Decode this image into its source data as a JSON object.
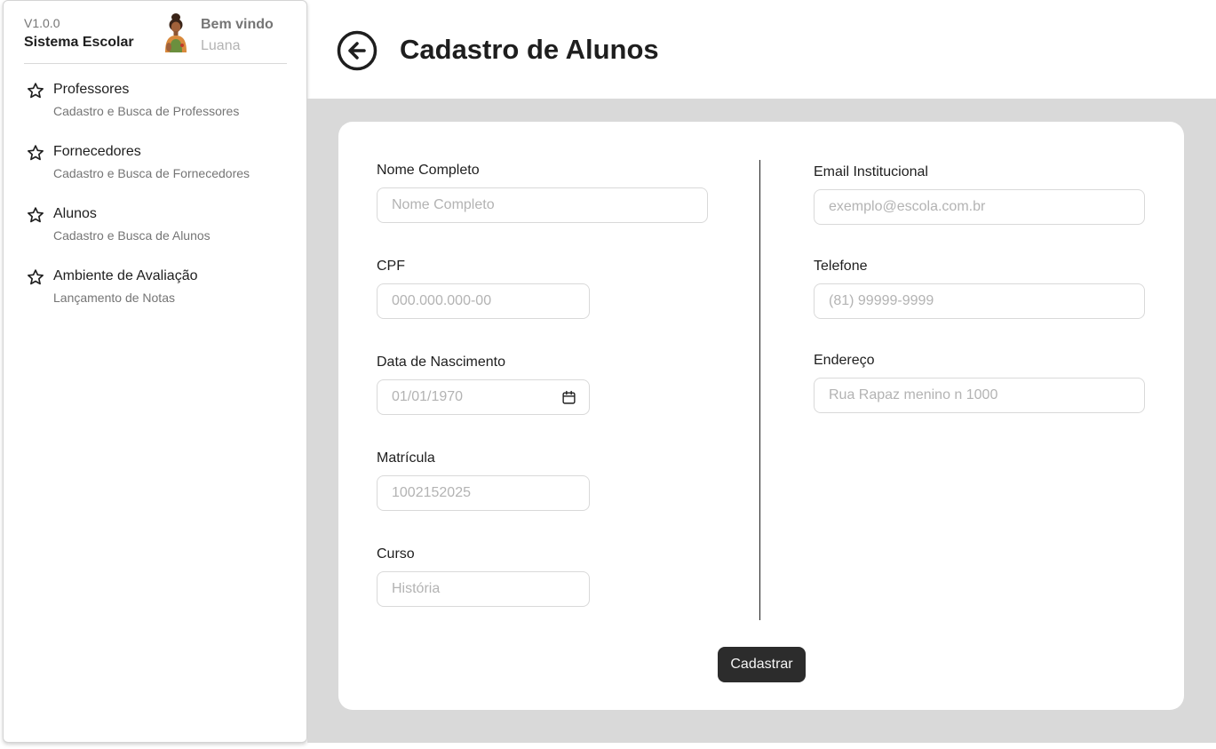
{
  "sidebar": {
    "version": "V1.0.0",
    "app_name": "Sistema Escolar",
    "welcome": "Bem vindo",
    "user_name": "Luana",
    "items": [
      {
        "label": "Professores",
        "description": "Cadastro e Busca de Professores",
        "icon": "star-icon"
      },
      {
        "label": "Fornecedores",
        "description": "Cadastro e Busca de Fornecedores",
        "icon": "star-icon"
      },
      {
        "label": "Alunos",
        "description": "Cadastro e Busca de Alunos",
        "icon": "star-icon"
      },
      {
        "label": "Ambiente de Avaliação",
        "description": "Lançamento de Notas",
        "icon": "star-icon"
      }
    ]
  },
  "header": {
    "title": "Cadastro de Alunos",
    "back_icon": "arrow-left-circle-icon"
  },
  "form": {
    "nome": {
      "label": "Nome Completo",
      "placeholder": "Nome Completo"
    },
    "cpf": {
      "label": "CPF",
      "placeholder": "000.000.000-00"
    },
    "nascimento": {
      "label": "Data de Nascimento",
      "placeholder": "01/01/1970",
      "icon": "calendar-icon"
    },
    "matricula": {
      "label": "Matrícula",
      "placeholder": "1002152025"
    },
    "curso": {
      "label": "Curso",
      "placeholder": "História"
    },
    "email": {
      "label": "Email Institucional",
      "placeholder": "exemplo@escola.com.br"
    },
    "telefone": {
      "label": "Telefone",
      "placeholder": "(81) 99999-9999"
    },
    "endereco": {
      "label": "Endereço",
      "placeholder": "Rua Rapaz menino n 1000"
    },
    "submit_label": "Cadastrar"
  },
  "colors": {
    "primary_button": "#2c2c2c",
    "content_background": "#d9d9d9",
    "card_background": "#ffffff",
    "placeholder_text": "#b3b3b3"
  }
}
